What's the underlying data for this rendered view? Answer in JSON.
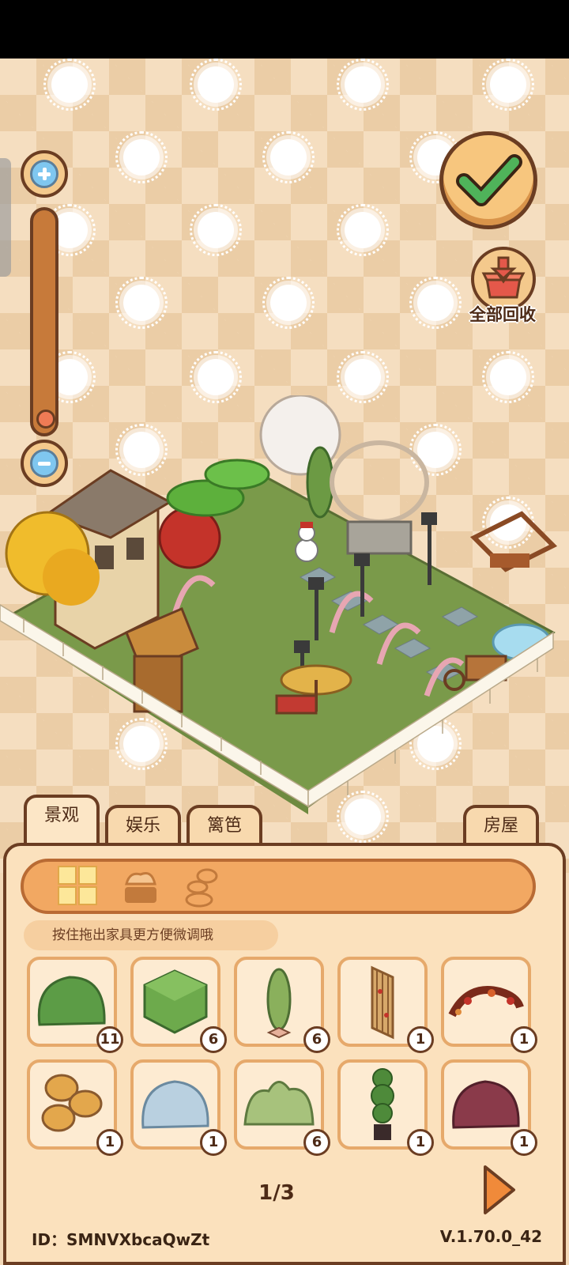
{
  "toolbar": {
    "recycle_label": "全部回收"
  },
  "tabs": [
    {
      "label": "景观",
      "active": true
    },
    {
      "label": "娱乐",
      "active": false
    },
    {
      "label": "篱笆",
      "active": false
    },
    {
      "label": "房屋",
      "active": false
    }
  ],
  "hint_text": "按住拖出家具更方便微调哦",
  "items": [
    {
      "icon": "green-bush-icon",
      "count": "11"
    },
    {
      "icon": "green-hedge-cube-icon",
      "count": "6"
    },
    {
      "icon": "cypress-tree-icon",
      "count": "6"
    },
    {
      "icon": "bamboo-fence-panel-icon",
      "count": "1"
    },
    {
      "icon": "autumn-leaf-arch-icon",
      "count": "1"
    },
    {
      "icon": "hay-bales-icon",
      "count": "1"
    },
    {
      "icon": "blue-bush-icon",
      "count": "1"
    },
    {
      "icon": "leafy-shrub-icon",
      "count": "6"
    },
    {
      "icon": "topiary-pot-icon",
      "count": "1"
    },
    {
      "icon": "maroon-bush-icon",
      "count": "1"
    }
  ],
  "pagination": {
    "label": "1/3"
  },
  "footer": {
    "id_text": "ID：SMNVXbcaQwZt",
    "version": "V.1.70.0_42"
  },
  "colors": {
    "outline": "#6b3d22",
    "panel": "#fbe1bd",
    "accent_orange": "#f2a862",
    "confirm_green": "#4fb35a"
  }
}
